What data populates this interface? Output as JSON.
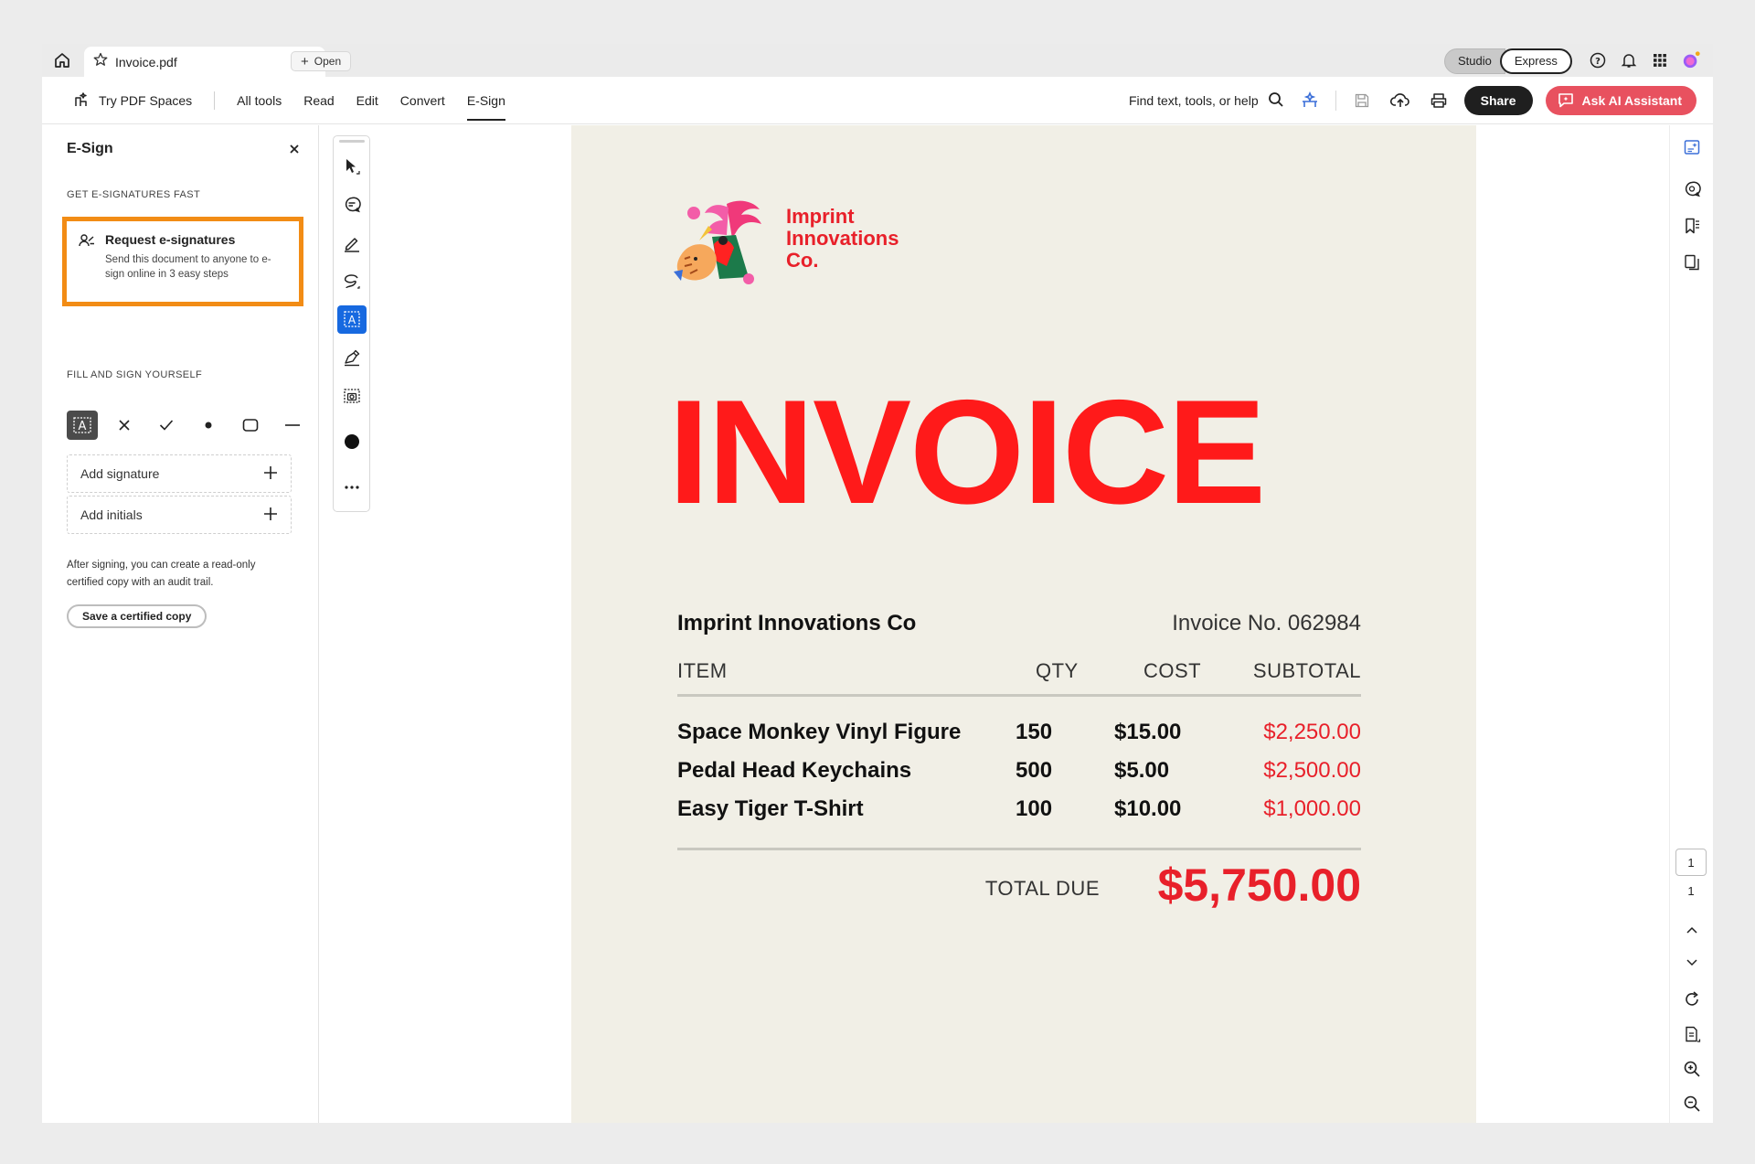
{
  "tab": {
    "title": "Invoice.pdf",
    "open_label": "Open"
  },
  "plans": {
    "studio": "Studio",
    "express": "Express"
  },
  "toolbar": {
    "spaces_label": "Try PDF Spaces",
    "items": [
      "All tools",
      "Read",
      "Edit",
      "Convert",
      "E-Sign"
    ],
    "active_item": "E-Sign",
    "find_label": "Find text, tools, or help",
    "share_label": "Share",
    "ai_label": "Ask AI Assistant"
  },
  "panel": {
    "title": "E-Sign",
    "section_fast": "GET E-SIGNATURES FAST",
    "request_title": "Request e-signatures",
    "request_desc": "Send this document to anyone to e-sign online in 3 easy steps",
    "section_fill": "FILL AND SIGN YOURSELF",
    "add_signature": "Add signature",
    "add_initials": "Add initials",
    "after_text": "After signing, you can create a read-only certified copy with an audit trail.",
    "cert_button": "Save a certified copy"
  },
  "document": {
    "logo_lines": [
      "Imprint",
      "Innovations",
      "Co."
    ],
    "title": "INVOICE",
    "company": "Imprint Innovations Co",
    "invoice_no": "Invoice No. 062984",
    "headers": {
      "item": "ITEM",
      "qty": "QTY",
      "cost": "COST",
      "subtotal": "SUBTOTAL"
    },
    "rows": [
      {
        "item": "Space Monkey Vinyl Figure",
        "qty": "150",
        "cost": "$15.00",
        "subtotal": "$2,250.00"
      },
      {
        "item": "Pedal Head Keychains",
        "qty": "500",
        "cost": "$5.00",
        "subtotal": "$2,500.00"
      },
      {
        "item": "Easy Tiger T-Shirt",
        "qty": "100",
        "cost": "$10.00",
        "subtotal": "$1,000.00"
      }
    ],
    "total_label": "TOTAL DUE",
    "total_value": "$5,750.00"
  },
  "pagination": {
    "current": "1",
    "total": "1"
  },
  "colors": {
    "accent_red": "#e8202a",
    "highlight": "#f28c15",
    "ai": "#e8515f",
    "active_tool": "#1769e0"
  }
}
